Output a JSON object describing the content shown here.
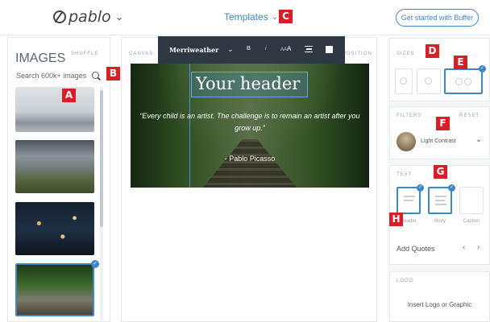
{
  "header": {
    "logo_text": "pablo",
    "logo_chevron": "chevron-down-icon",
    "templates_label": "Templates",
    "cta_label": "Get started with Buffer",
    "accent_color": "#3f86c7"
  },
  "markers": [
    "A",
    "B",
    "C",
    "D",
    "E",
    "F",
    "G",
    "H"
  ],
  "images_panel": {
    "title": "IMAGES",
    "shuffle_label": "SHUFFLE",
    "search_placeholder": "Search 600k+ images"
  },
  "canvas": {
    "canvas_label": "CANVAS",
    "position_label": "POSITION",
    "toolbar": {
      "font_name": "Merriweather",
      "bold_label": "B",
      "italic_label": "i",
      "size_small": "AA",
      "size_large": "A"
    },
    "header_text": "Your header",
    "quote_text": "“Every child is an artist. The challenge is to remain an artist after you grow up.”",
    "author_text": "- Pablo Picasso"
  },
  "sidebar": {
    "sizes_label": "SIZES",
    "filters_label": "FILTERS",
    "filters_reset": "RESET",
    "filter_selected": "Light Contrast",
    "text_label": "TEXT",
    "text_templates": [
      "Header",
      "Body",
      "Caption"
    ],
    "add_quotes_label": "Add Quotes",
    "logo_label": "LOGO",
    "insert_logo_label": "Insert Logo or Graphic"
  }
}
